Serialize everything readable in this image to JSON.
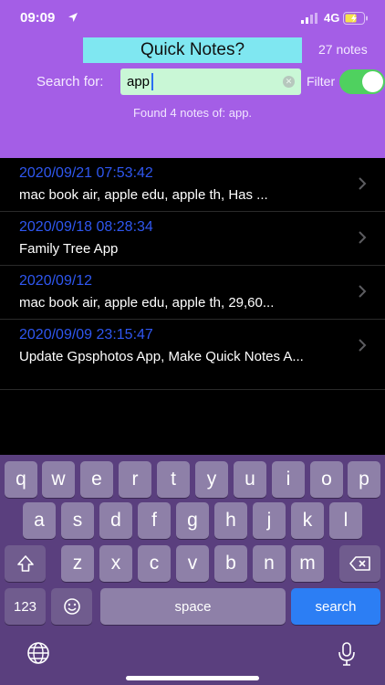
{
  "status": {
    "time": "09:09",
    "network": "4G"
  },
  "header": {
    "title": "Quick Notes?",
    "count": "27 notes",
    "search_label": "Search for:",
    "search_value": "app",
    "filter_label": "Filter",
    "filter_on": true,
    "found_text": "Found 4 notes of: app."
  },
  "notes": [
    {
      "date": "2020/09/21 07:53:42",
      "text": "mac book air, apple edu, apple th,  Has ..."
    },
    {
      "date": "2020/09/18 08:28:34",
      "text": "Family Tree App"
    },
    {
      "date": "2020/09/12",
      "text": "mac book air, apple edu, apple th, 29,60..."
    },
    {
      "date": "2020/09/09 23:15:47",
      "text": "Update Gpsphotos App, Make Quick Notes A..."
    }
  ],
  "keyboard": {
    "row1": [
      "q",
      "w",
      "e",
      "r",
      "t",
      "y",
      "u",
      "i",
      "o",
      "p"
    ],
    "row2": [
      "a",
      "s",
      "d",
      "f",
      "g",
      "h",
      "j",
      "k",
      "l"
    ],
    "row3": [
      "z",
      "x",
      "c",
      "v",
      "b",
      "n",
      "m"
    ],
    "numbers": "123",
    "space": "space",
    "search": "search"
  },
  "colors": {
    "header": "#a45ee6",
    "title_bg": "#7fe7f1",
    "search_bg": "#c9f7d6",
    "date": "#2f57f0",
    "toggle": "#4fd15f",
    "search_key": "#2c7ef4"
  },
  "icons": {
    "location": "location-arrow-icon",
    "signal": "signal-icon",
    "battery": "battery-charging-icon",
    "chevron": "chevron-right-icon",
    "shift": "shift-icon",
    "backspace": "backspace-icon",
    "emoji": "emoji-icon",
    "globe": "globe-icon",
    "mic": "microphone-icon"
  }
}
